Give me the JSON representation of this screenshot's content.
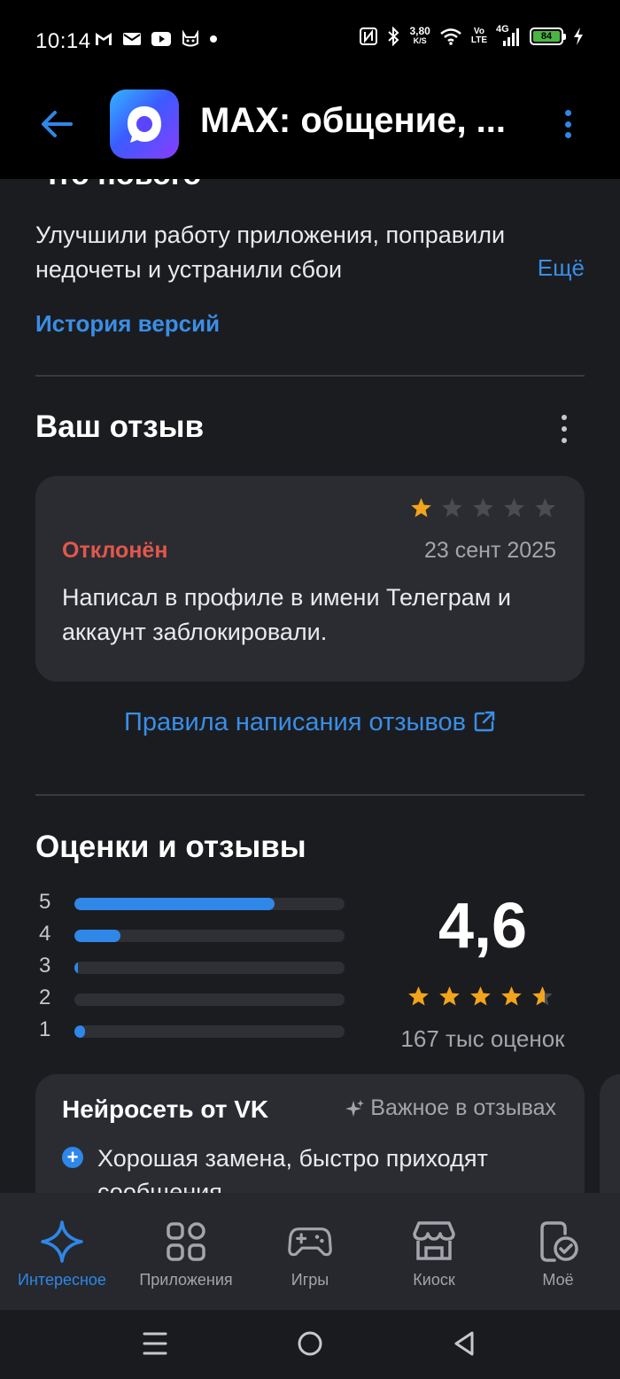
{
  "status_bar": {
    "time": "10:14",
    "speed_value": "3,80",
    "speed_unit": "K/S",
    "volte_top": "Vo",
    "volte_bottom": "LTE",
    "network": "4G",
    "battery": "84"
  },
  "header": {
    "app_title": "MAX: общение, ..."
  },
  "whats_new": {
    "heading": "Что нового",
    "text": "Улучшили работу приложения, поправили недочеты и устранили сбои",
    "more_label": "Ещё",
    "history_label": "История версий"
  },
  "your_review": {
    "title": "Ваш отзыв",
    "rating": 1,
    "max_rating": 5,
    "status": "Отклонён",
    "date": "23 сент 2025",
    "text": "Написал в профиле в имени Телеграм и аккаунт заблокировали.",
    "rules_link": "Правила написания отзывов"
  },
  "ratings": {
    "title": "Оценки и отзывы",
    "score": "4,6",
    "stars_value": 4.6,
    "count_label": "167 тыс оценок",
    "distribution": [
      {
        "label": "5",
        "fraction": 0.74
      },
      {
        "label": "4",
        "fraction": 0.17
      },
      {
        "label": "3",
        "fraction": 0.01
      },
      {
        "label": "2",
        "fraction": 0.0
      },
      {
        "label": "1",
        "fraction": 0.04
      }
    ]
  },
  "ai_summary": {
    "title": "Нейросеть от VK",
    "badge": "Важное в отзывах",
    "point": "Хорошая замена, быстро приходят сообщения"
  },
  "bottom_nav": [
    {
      "label": "Интересное",
      "icon": "sparkle-icon",
      "active": true
    },
    {
      "label": "Приложения",
      "icon": "apps-grid-icon",
      "active": false
    },
    {
      "label": "Игры",
      "icon": "gamepad-icon",
      "active": false
    },
    {
      "label": "Киоск",
      "icon": "store-icon",
      "active": false
    },
    {
      "label": "Моё",
      "icon": "my-apps-icon",
      "active": false
    }
  ],
  "colors": {
    "accent": "#2f87e8",
    "star": "#f2a51a",
    "rejected": "#e2574c",
    "background": "#1b1c20",
    "card": "#2a2c31"
  }
}
